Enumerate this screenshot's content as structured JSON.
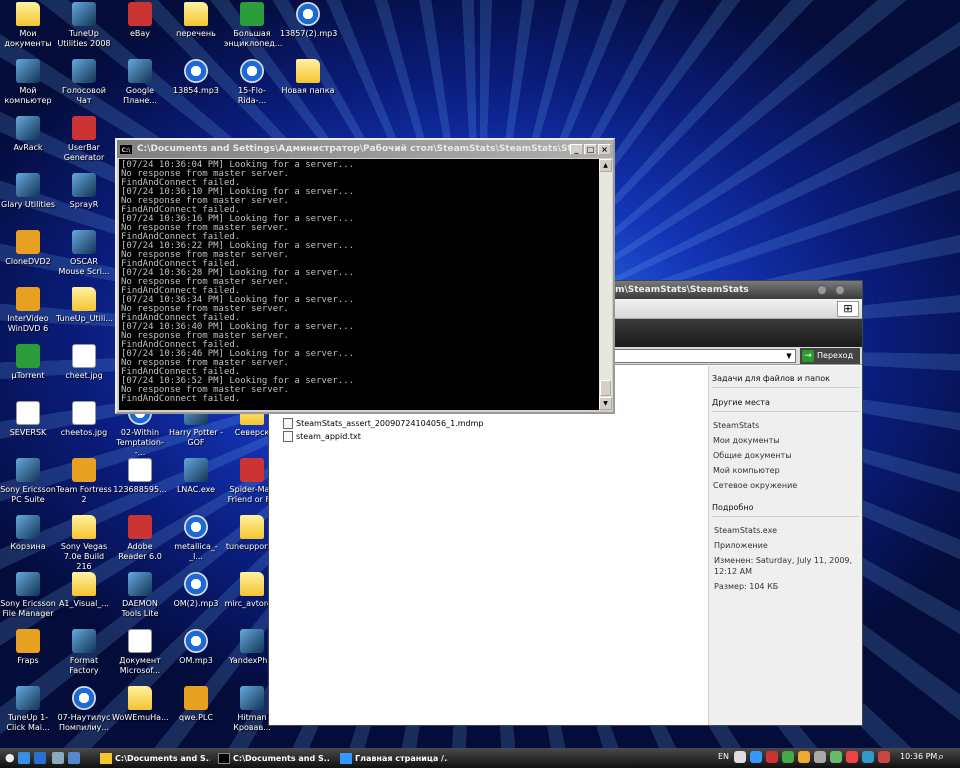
{
  "desktop_icons": [
    {
      "label": "Мои документы",
      "type": "folder"
    },
    {
      "label": "TuneUp Utilities 2008",
      "type": "app"
    },
    {
      "label": "eBay",
      "type": "red"
    },
    {
      "label": "перечень",
      "type": "folder"
    },
    {
      "label": "Большая энциклопед...",
      "type": "green"
    },
    {
      "label": "13857(2).mp3",
      "type": "media"
    },
    {
      "label": "Мой компьютер",
      "type": "app"
    },
    {
      "label": "Голосовой Чат",
      "type": "app"
    },
    {
      "label": "Google Плане...",
      "type": "app"
    },
    {
      "label": "13854.mp3",
      "type": "media"
    },
    {
      "label": "15-Flo-Rida-...",
      "type": "media"
    },
    {
      "label": "Новая папка",
      "type": "folder"
    },
    {
      "label": "AvRack",
      "type": "app"
    },
    {
      "label": "UserBar Generator",
      "type": "red"
    },
    {
      "label": "Glary Utilities",
      "type": "app"
    },
    {
      "label": "SprayR",
      "type": "app"
    },
    {
      "label": "CloneDVD2",
      "type": "orange"
    },
    {
      "label": "OSCAR Mouse Scri...",
      "type": "app"
    },
    {
      "label": "InterVideo WinDVD 6",
      "type": "orange"
    },
    {
      "label": "TuneUp_Utili...",
      "type": "folder"
    },
    {
      "label": "µTorrent",
      "type": "green"
    },
    {
      "label": "cheet.jpg",
      "type": "doc"
    },
    {
      "label": "SEVERSK",
      "type": "doc"
    },
    {
      "label": "cheetos.jpg",
      "type": "doc"
    },
    {
      "label": "02-Within Temptation--...",
      "type": "media"
    },
    {
      "label": "Harry Potter - GOF",
      "type": "app"
    },
    {
      "label": "Северск",
      "type": "folder"
    },
    {
      "label": "Sony Ericsson PC Suite",
      "type": "app"
    },
    {
      "label": "Team Fortress 2",
      "type": "orange"
    },
    {
      "label": "123688595...",
      "type": "doc"
    },
    {
      "label": "LNAC.exe",
      "type": "app"
    },
    {
      "label": "Spider-Man Friend or F...",
      "type": "red"
    },
    {
      "label": "Корзина",
      "type": "app"
    },
    {
      "label": "Sony Vegas 7.0e Build 216",
      "type": "folder"
    },
    {
      "label": "Adobe Reader 6.0",
      "type": "red"
    },
    {
      "label": "metallica_-_l...",
      "type": "media"
    },
    {
      "label": "tuneupport...",
      "type": "folder"
    },
    {
      "label": "Sony Ericsson File Manager",
      "type": "app"
    },
    {
      "label": "A1_Visual_...",
      "type": "folder"
    },
    {
      "label": "DAEMON Tools Lite",
      "type": "app"
    },
    {
      "label": "OM(2).mp3",
      "type": "media"
    },
    {
      "label": "mirc_avtore...",
      "type": "folder"
    },
    {
      "label": "Fraps",
      "type": "orange"
    },
    {
      "label": "Format Factory",
      "type": "app"
    },
    {
      "label": "Документ Microsof...",
      "type": "doc"
    },
    {
      "label": "OM.mp3",
      "type": "media"
    },
    {
      "label": "YandexPh...",
      "type": "app"
    },
    {
      "label": "TuneUp 1-Click Mai...",
      "type": "app"
    },
    {
      "label": "07-Наутилус Помпилиу...",
      "type": "media"
    },
    {
      "label": "WoWEmuHa...",
      "type": "folder"
    },
    {
      "label": "qwe.PLC",
      "type": "orange"
    },
    {
      "label": "Hitman Кровав...",
      "type": "app"
    }
  ],
  "console": {
    "title": "C:\\Documents and Settings\\Администратор\\Рабочий стол\\SteamStats\\SteamStats\\SteamStats.exe",
    "lines": [
      "[07/24 10:36:04 PM] Looking for a server...",
      "No response from master server.",
      "FindAndConnect failed.",
      "[07/24 10:36:10 PM] Looking for a server...",
      "No response from master server.",
      "FindAndConnect failed.",
      "[07/24 10:36:16 PM] Looking for a server...",
      "No response from master server.",
      "FindAndConnect failed.",
      "[07/24 10:36:22 PM] Looking for a server...",
      "No response from master server.",
      "FindAndConnect failed.",
      "[07/24 10:36:28 PM] Looking for a server...",
      "No response from master server.",
      "FindAndConnect failed.",
      "[07/24 10:36:34 PM] Looking for a server...",
      "No response from master server.",
      "FindAndConnect failed.",
      "[07/24 10:36:40 PM] Looking for a server...",
      "No response from master server.",
      "FindAndConnect failed.",
      "[07/24 10:36:46 PM] Looking for a server...",
      "No response from master server.",
      "FindAndConnect failed.",
      "[07/24 10:36:52 PM] Looking for a server...",
      "No response from master server.",
      "FindAndConnect failed."
    ],
    "minimize": "_",
    "maximize": "□",
    "close": "×"
  },
  "explorer": {
    "title": "am\\SteamStats\\SteamStats",
    "address": "ts",
    "go_label": "Переход",
    "files": [
      "SteamStats_assert_20090724104056_1.mdmp",
      "steam_appid.txt"
    ],
    "side": {
      "tasks_header": "Задачи для файлов и папок",
      "places_header": "Другие места",
      "places": [
        "SteamStats",
        "Мои документы",
        "Общие документы",
        "Мой компьютер",
        "Сетевое окружение"
      ],
      "details_header": "Подробно",
      "details": [
        "SteamStats.exe",
        "Приложение",
        "Изменен: Saturday, July 11, 2009, 12:12 AM",
        "Размер: 104 КБ"
      ]
    }
  },
  "taskbar": {
    "tasks": [
      "C:\\Documents and S...",
      "C:\\Documents and S...",
      "Главная страница /..."
    ],
    "language": "EN",
    "clock": "10:36 PM"
  }
}
